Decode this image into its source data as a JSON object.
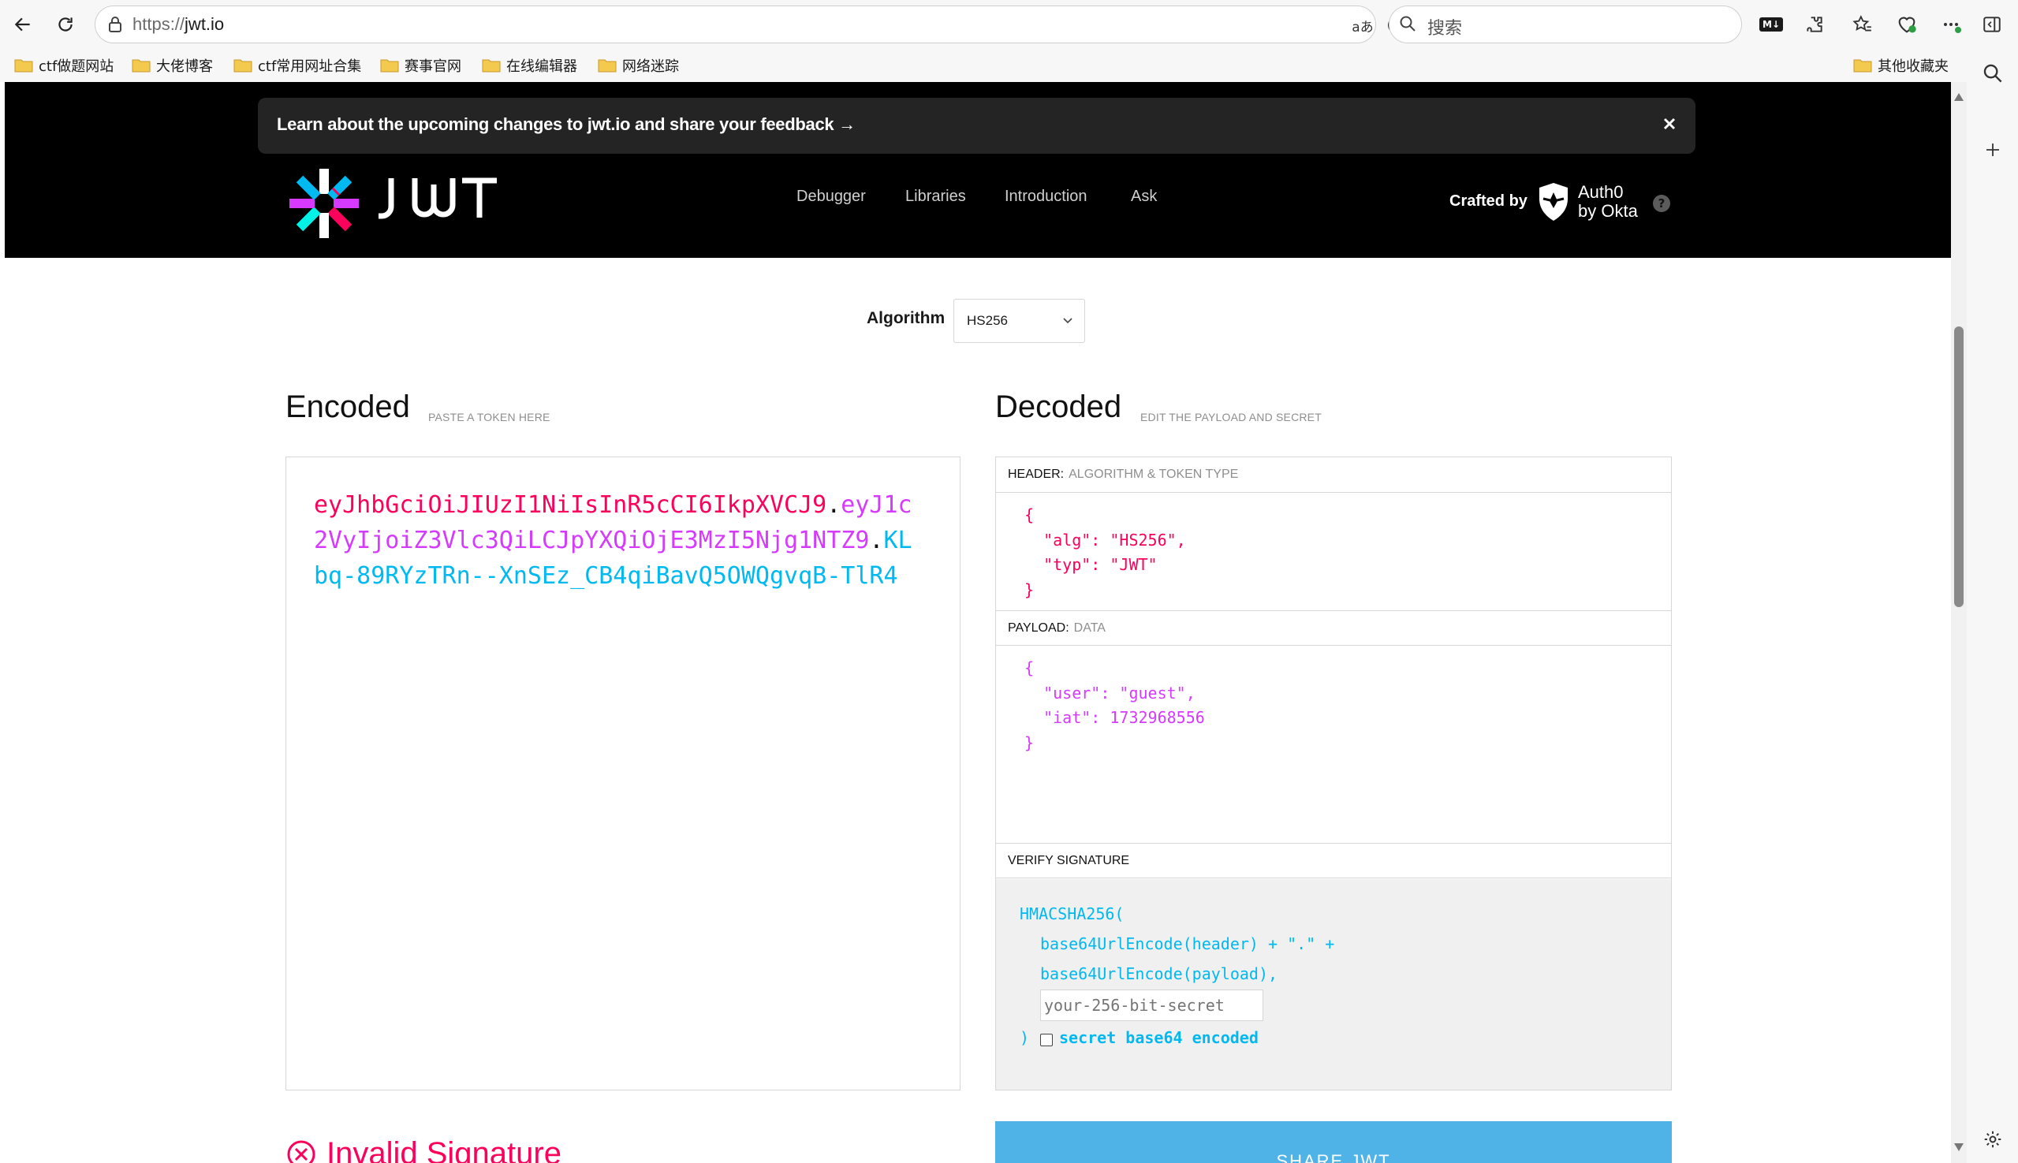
{
  "browser": {
    "url_protocol": "https://",
    "url_host": "jwt.io",
    "search_placeholder": "搜索",
    "translate_glyph": "aあ",
    "extensions_badge": "M↓"
  },
  "bookmarks": [
    {
      "label": "ctf做题网站"
    },
    {
      "label": "大佬博客"
    },
    {
      "label": "ctf常用网址合集"
    },
    {
      "label": "赛事官网"
    },
    {
      "label": "在线编辑器"
    },
    {
      "label": "网络迷踪"
    }
  ],
  "bookmarks_other": "其他收藏夹",
  "site": {
    "banner_text": "Learn about the upcoming changes to jwt.io and share your feedback →",
    "logo_wordmark": "JWT",
    "nav": [
      "Debugger",
      "Libraries",
      "Introduction",
      "Ask"
    ],
    "crafted_by": "Crafted by",
    "auth0_line1": "Auth0",
    "auth0_line2": "by Okta",
    "help": "?"
  },
  "algorithm": {
    "label": "Algorithm",
    "selected": "HS256"
  },
  "encoded": {
    "title": "Encoded",
    "subtitle": "PASTE A TOKEN HERE",
    "token_header": "eyJhbGciOiJIUzI1NiIsInR5cCI6IkpXVCJ9",
    "token_payload": "eyJ1c2VyIjoiZ3Vlc3QiLCJpYXQiOjE3MzI5Njg1NTZ9",
    "token_signature": "KLbq-89RYzTRn--XnSEz_CB4qiBavQ5OWQgvqB-TlR4",
    "dot": "."
  },
  "decoded": {
    "title": "Decoded",
    "subtitle": "EDIT THE PAYLOAD AND SECRET",
    "header_label": "HEADER:",
    "header_sub": "ALGORITHM & TOKEN TYPE",
    "header_json": "{\n  \"alg\": \"HS256\",\n  \"typ\": \"JWT\"\n}",
    "payload_label": "PAYLOAD:",
    "payload_sub": "DATA",
    "payload_json": "{\n  \"user\": \"guest\",\n  \"iat\": 1732968556\n}",
    "verify_label": "VERIFY SIGNATURE",
    "verify_fn": "HMACSHA256(",
    "verify_line2": "base64UrlEncode(header) + \".\" +",
    "verify_line3": "base64UrlEncode(payload),",
    "secret_placeholder": "your-256-bit-secret",
    "verify_close": ")",
    "base64_label": "secret base64 encoded"
  },
  "status": {
    "invalid_signature": "Invalid Signature"
  },
  "share_button": "SHARE JWT",
  "colors": {
    "header": "#fb015b",
    "payload": "#d63aff",
    "signature": "#00b9f1"
  }
}
